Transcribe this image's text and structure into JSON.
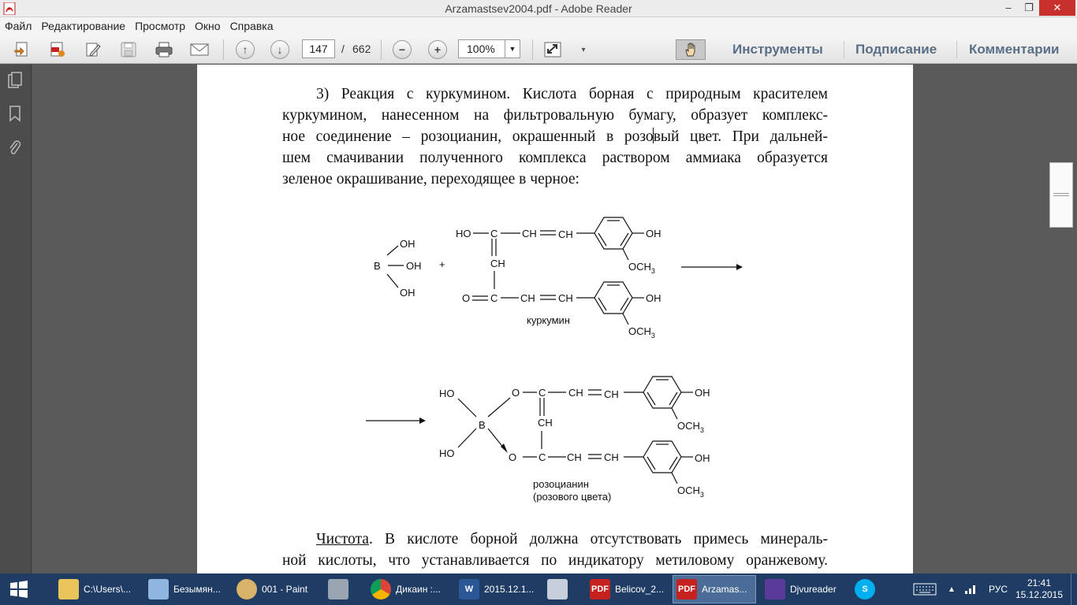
{
  "window": {
    "title": "Arzamastsev2004.pdf - Adobe Reader",
    "minimize": "–",
    "restore": "❐",
    "close": "✕"
  },
  "menu": {
    "items": [
      "Файл",
      "Редактирование",
      "Просмотр",
      "Окно",
      "Справка"
    ]
  },
  "toolbar": {
    "page_current": "147",
    "page_separator": "/",
    "page_total": "662",
    "zoom": "100%",
    "tools_label": "Инструменты",
    "sign_label": "Подписание",
    "comments_label": "Комментарии"
  },
  "document": {
    "para1": {
      "line1": "3) Реакция с куркумином. Кислота борная с природным красителем",
      "line2": "куркумином, нанесенном на фильтровальную бумагу, образует комплекс-",
      "line3a": "ное соединение – розоцианин, окрашенный в розо",
      "line3b": "вый цвет. При дальней-",
      "line4": "шем смачивании полученного комплекса раствором аммиака образуется",
      "line5": "зеленое окрашивание, переходящее в черное:"
    },
    "para2": {
      "lead": "Чистота",
      "line1_rest": ". В кислоте борной должна отсутствовать примесь минераль-",
      "line2": "ной кислоты, что устанавливается по индикатору метиловому оранжевому."
    },
    "chem": {
      "B": "B",
      "OH": "OH",
      "plus": "+",
      "HO": "HO",
      "C": "C",
      "CH": "CH",
      "O": "O",
      "OCH": "OCH",
      "sub3": "3",
      "curcumin_label": "куркумин",
      "rosocyanin_label": "розоцианин",
      "rosocyanin_sub": "(розового цвета)"
    }
  },
  "taskbar": {
    "items": [
      {
        "label": "C:\\Users\\...",
        "icon": "folder-icon"
      },
      {
        "label": "Безымян...",
        "icon": "notepad-icon"
      },
      {
        "label": "001 - Paint",
        "icon": "paint-icon"
      },
      {
        "label": "",
        "icon": "calculator-icon"
      },
      {
        "label": "Дикаин :...",
        "icon": "chrome-icon"
      },
      {
        "label": "2015.12.1...",
        "icon": "word-icon"
      },
      {
        "label": "",
        "icon": "tool-icon"
      },
      {
        "label": "Belicov_2...",
        "icon": "pdf-icon"
      },
      {
        "label": "Arzamas...",
        "icon": "pdf-icon"
      },
      {
        "label": "Djvureader",
        "icon": "djvu-icon"
      },
      {
        "label": "",
        "icon": "skype-icon"
      }
    ],
    "lang": "РУС",
    "time": "21:41",
    "date": "15.12.2015"
  },
  "colors": {
    "taskbar_bg": "#1e3c64",
    "toolbar_link": "#5a6f86",
    "close_button": "#c7302b",
    "pdf_red": "#c5221f"
  }
}
